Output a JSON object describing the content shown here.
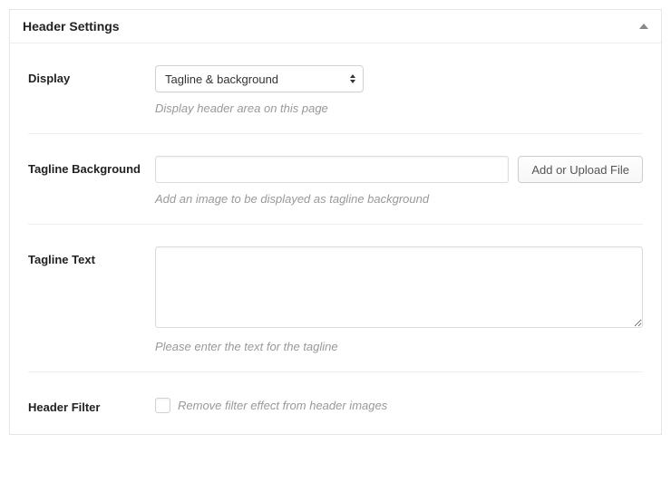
{
  "panel": {
    "title": "Header Settings"
  },
  "fields": {
    "display": {
      "label": "Display",
      "value": "Tagline & background",
      "help": "Display header area on this page"
    },
    "tagline_bg": {
      "label": "Tagline Background",
      "value": "",
      "button": "Add or Upload File",
      "help": "Add an image to be displayed as tagline background"
    },
    "tagline_text": {
      "label": "Tagline Text",
      "value": "",
      "help": "Please enter the text for the tagline"
    },
    "header_filter": {
      "label": "Header Filter",
      "checkbox_label": "Remove filter effect from header images"
    }
  }
}
